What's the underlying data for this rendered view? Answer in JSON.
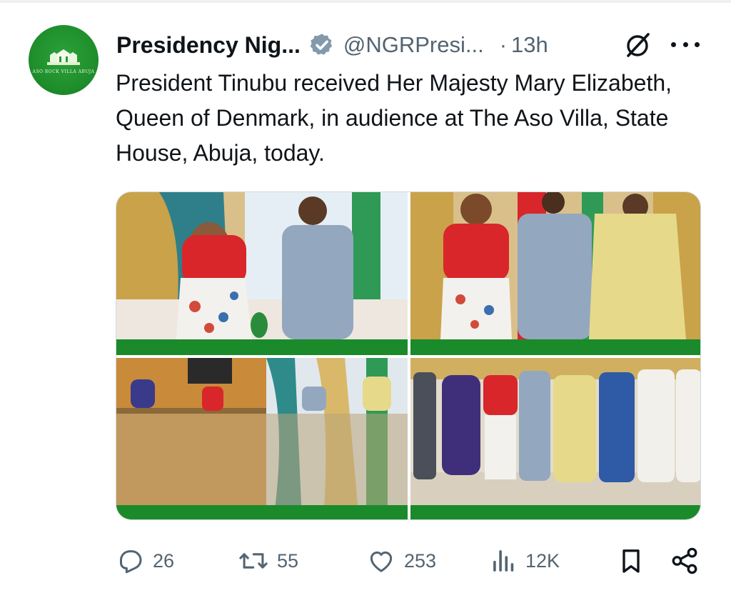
{
  "author": {
    "display_name": "Presidency Nig...",
    "handle": "@NGRPresi...",
    "separator": "·",
    "time": "13h",
    "avatar_text": "ASO ROCK VILLA ABUJA",
    "verified": true
  },
  "tweet": {
    "text": "President Tinubu received Her Majesty Mary Elizabeth, Queen of Denmark, in audience at The Aso Villa, State House, Abuja, today."
  },
  "media": {
    "count": 4,
    "photos": [
      "photo-1",
      "photo-2",
      "photo-3",
      "photo-4"
    ]
  },
  "actions": {
    "replies": "26",
    "reposts": "55",
    "likes": "253",
    "views": "12K"
  },
  "icons": {
    "reply": "reply-icon",
    "repost": "repost-icon",
    "like": "like-icon",
    "views": "views-icon",
    "bookmark": "bookmark-icon",
    "share": "share-icon",
    "grok": "grok-icon",
    "more": "more-icon",
    "verified": "verified-badge-icon"
  },
  "colors": {
    "text": "#0f1419",
    "secondary": "#536471",
    "avatar_green": "#1f8f2c",
    "photo_banner_green": "#1a8a2a"
  }
}
